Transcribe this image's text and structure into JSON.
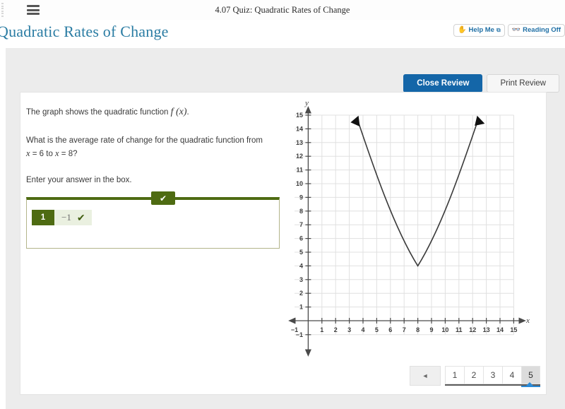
{
  "browser_bar": {
    "title": "4.07 Quiz: Quadratic Rates of Change",
    "menu_icon": "hamburger-icon"
  },
  "lesson_header": {
    "title": "Quadratic Rates of Change",
    "buttons": [
      {
        "label": "Help Me",
        "icon": "hand-icon",
        "suffix": "⧉"
      },
      {
        "label": "Reading Off",
        "icon": "glasses-icon",
        "suffix": ""
      }
    ]
  },
  "review_toolbar": {
    "close_label": "Close Review",
    "print_label": "Print Review"
  },
  "question": {
    "intro_prefix": "The graph shows the quadratic function ",
    "function_notation": "f (x)",
    "intro_suffix": ".",
    "prompt_line1": "What is the average rate of change for the quadratic function from",
    "prompt_line2_pre": "",
    "prompt_x1": "x",
    "prompt_mid": " = 6 to ",
    "prompt_x2": "x",
    "prompt_end": " = 8?",
    "instruction": "Enter your answer in the box."
  },
  "answer_box": {
    "tab_icon": "check-icon",
    "tab_glyph": "✔",
    "number_badge": "1",
    "value": "−1",
    "correct_icon": "check-icon",
    "correct_glyph": "✔",
    "accent_color": "#4e6b12"
  },
  "pagination": {
    "prev_glyph": "◄",
    "pages": [
      "1",
      "2",
      "3",
      "4",
      "5"
    ],
    "active_page": "5",
    "active_color": "#2b8ad6"
  },
  "chart_data": {
    "type": "line",
    "title": "",
    "xlabel": "x",
    "ylabel": "y",
    "xlim": [
      -1,
      15
    ],
    "ylim": [
      -1,
      15
    ],
    "xticks": [
      -1,
      1,
      2,
      3,
      4,
      5,
      6,
      7,
      8,
      9,
      10,
      11,
      12,
      13,
      14,
      15
    ],
    "yticks": [
      -1,
      1,
      2,
      3,
      4,
      5,
      6,
      7,
      8,
      9,
      10,
      11,
      12,
      13,
      14,
      15
    ],
    "grid": true,
    "legend": "none",
    "curve": {
      "name": "f(x)",
      "form": "quadratic",
      "vertex": [
        8,
        4
      ],
      "leading_coefficient": 0.7,
      "equation": "f(x) = 0.7(x - 8)^2 + 4",
      "domain_drawn": [
        3.4,
        12.6
      ],
      "arrow_start": [
        3.4,
        14.7
      ],
      "arrow_end": [
        12.6,
        14.7
      ],
      "points": [
        [
          3.4,
          14.7
        ],
        [
          4,
          15.0
        ],
        [
          4,
          15.0
        ],
        [
          5,
          10.3
        ],
        [
          6,
          6.8
        ],
        [
          7,
          4.7
        ],
        [
          8,
          4.0
        ],
        [
          9,
          4.7
        ],
        [
          10,
          6.8
        ],
        [
          11,
          10.3
        ],
        [
          12,
          15.0
        ],
        [
          12.6,
          14.7
        ]
      ],
      "color": "#3a3a3a"
    },
    "annotations": {
      "x_axis_arrows": "both",
      "y_axis_arrows": "both"
    }
  }
}
